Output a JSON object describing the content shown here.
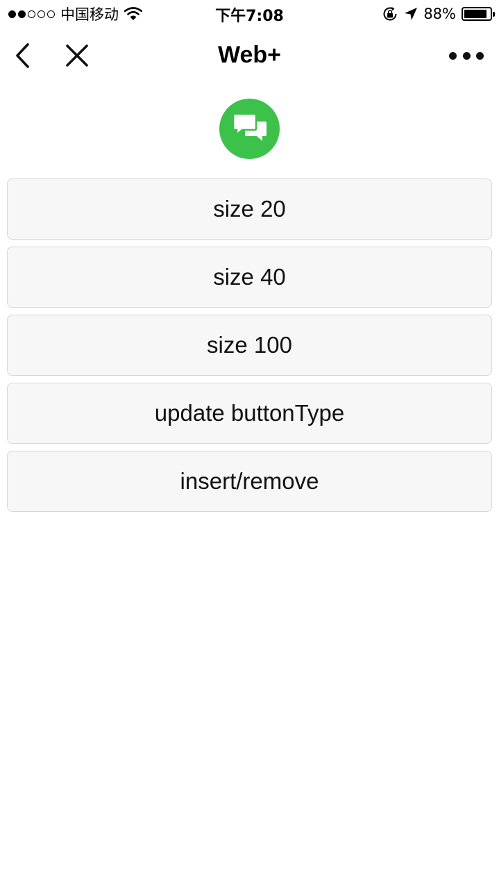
{
  "status_bar": {
    "signal_dots": [
      "full",
      "full",
      "empty",
      "empty",
      "empty"
    ],
    "carrier": "中国移动",
    "time": "下午7:08",
    "battery_percent": "88%",
    "battery_level": 0.88,
    "icons": [
      "wifi-icon",
      "orientation-lock-icon",
      "location-arrow-icon",
      "battery-icon"
    ]
  },
  "nav": {
    "title": "Web+",
    "back_icon": "chevron-left-icon",
    "close_icon": "close-icon",
    "more_icon": "more-dots-icon"
  },
  "contact_button": {
    "icon": "chat-bubbles-icon",
    "color": "#3cc24a"
  },
  "buttons": [
    {
      "label": "size 20"
    },
    {
      "label": "size 40"
    },
    {
      "label": "size 100"
    },
    {
      "label": "update buttonType"
    },
    {
      "label": "insert/remove"
    }
  ]
}
